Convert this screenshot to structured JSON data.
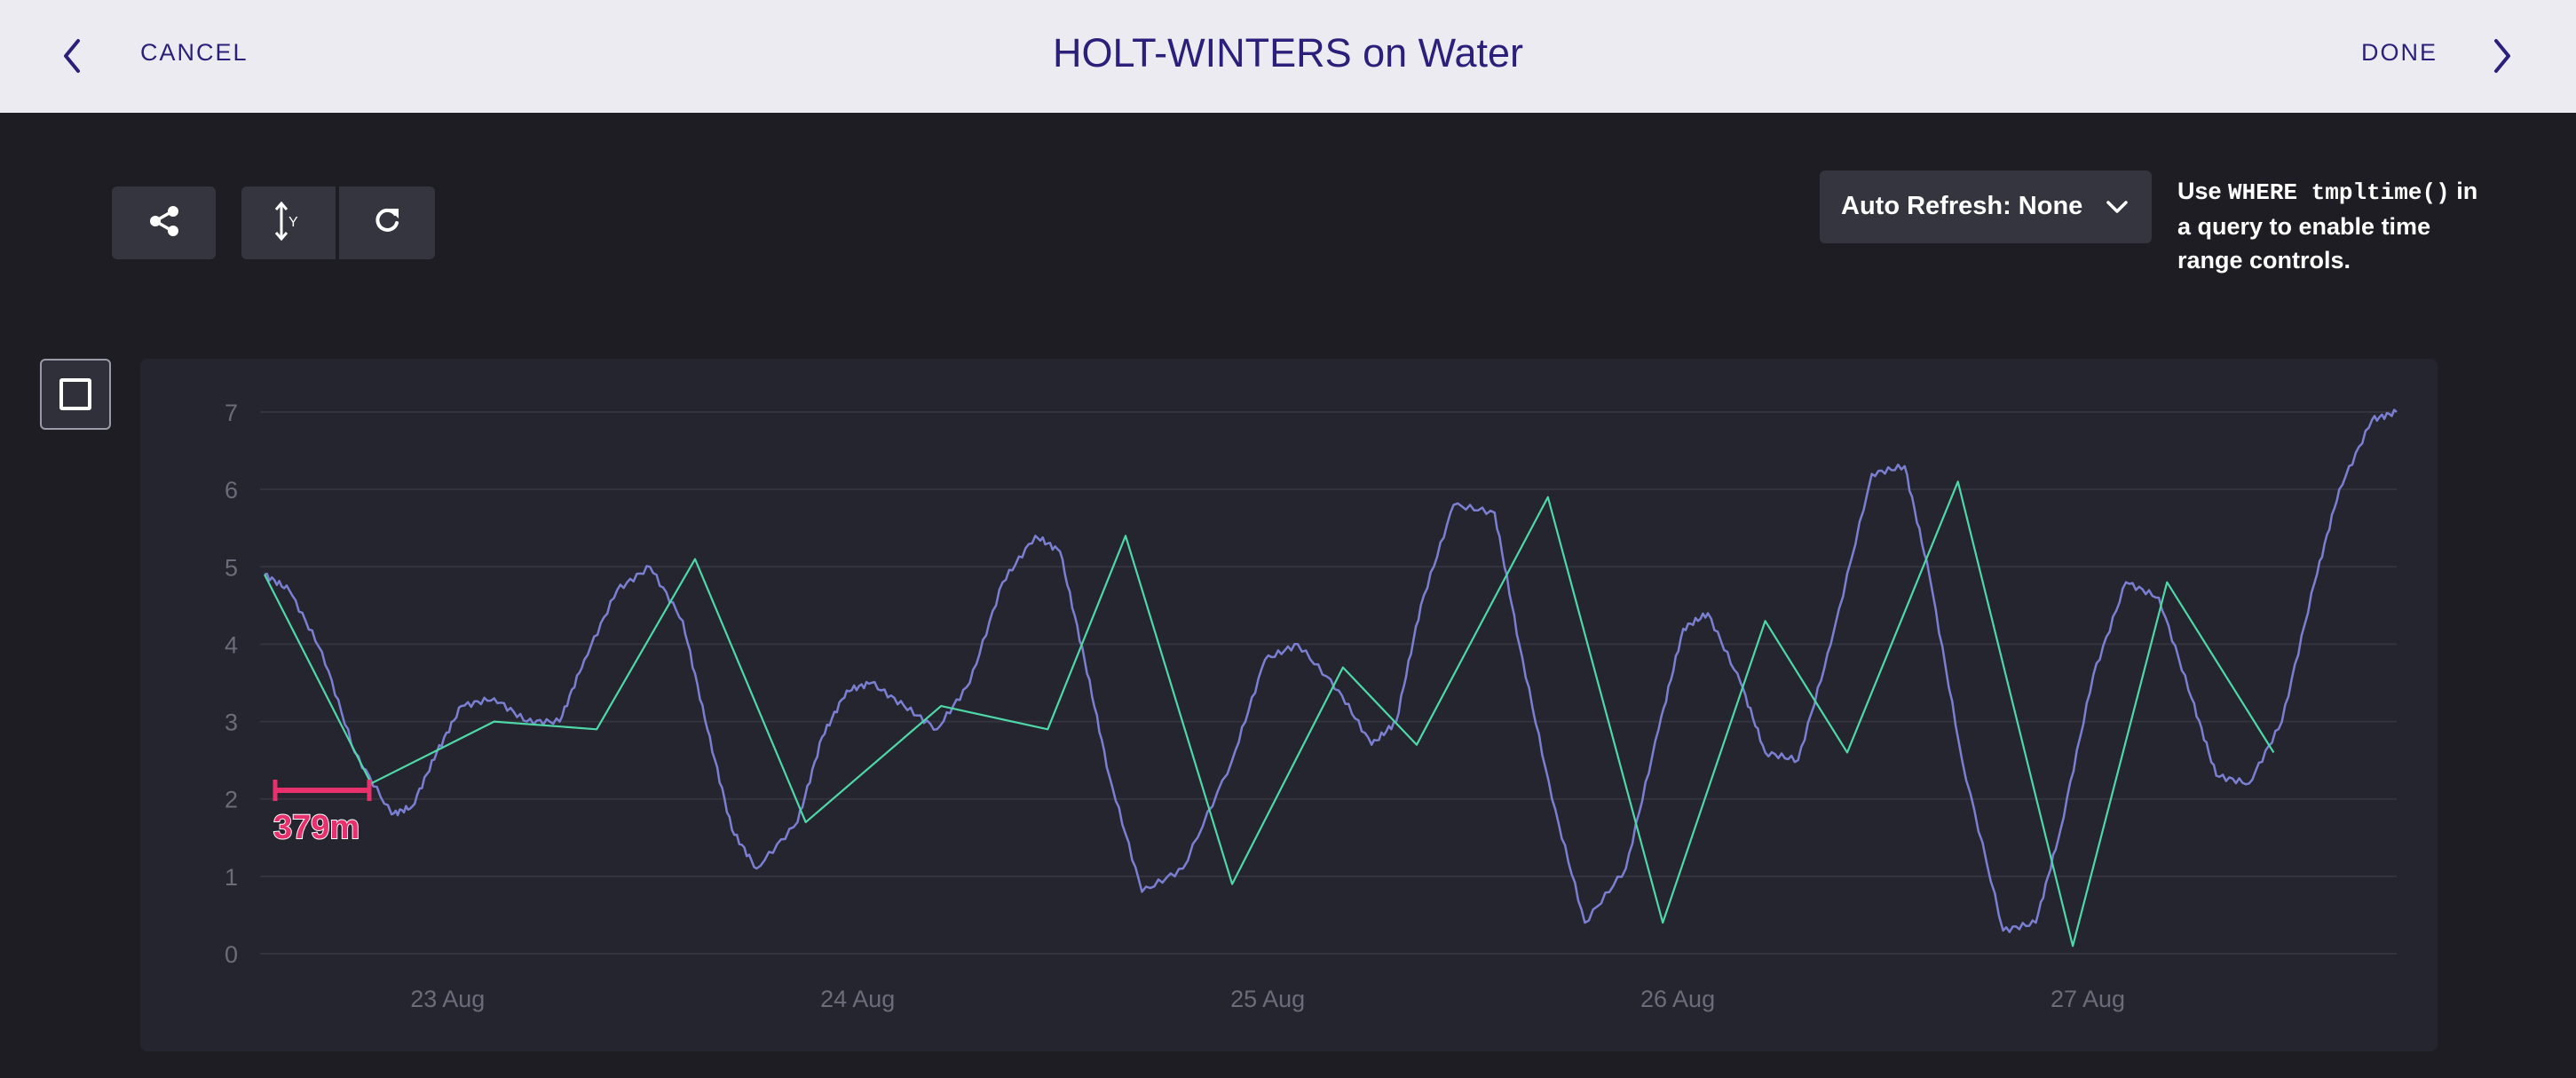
{
  "navbar": {
    "cancel_label": "CANCEL",
    "title": "HOLT-WINTERS on Water",
    "done_label": "DONE"
  },
  "toolbar": {
    "icons": [
      "share-icon",
      "y-axis-icon",
      "refresh-icon"
    ],
    "auto_refresh_label": "Auto Refresh: None",
    "hint_prefix": "Use ",
    "hint_code": "WHERE tmpltime()",
    "hint_suffix": " in a query to enable time range controls."
  },
  "colors": {
    "navbar_bg": "#ebebf1",
    "accent": "#2a1f7a",
    "background": "#1d1d23",
    "panel": "#25252f",
    "raw_series": "#7b7fd1",
    "forecast_series": "#4ed8a8",
    "interval_marker": "#e8306c"
  },
  "chart_data": {
    "type": "line",
    "y_ticks": [
      "0",
      "1",
      "2",
      "3",
      "4",
      "5",
      "6",
      "7"
    ],
    "ylim": [
      0,
      7
    ],
    "x_ticks": [
      "23 Aug",
      "24 Aug",
      "25 Aug",
      "26 Aug",
      "27 Aug"
    ],
    "xlim_days": [
      22.64,
      27.84
    ],
    "grid": true,
    "interval_label": "379m",
    "series": [
      {
        "color": "#7b7fd1",
        "x": [
          22.64,
          22.7,
          22.78,
          22.86,
          22.95,
          23.0,
          23.06,
          23.12,
          23.2,
          23.28,
          23.36,
          23.42,
          23.5,
          23.58,
          23.66,
          23.72,
          23.78,
          23.84,
          23.94,
          24.0,
          24.06,
          24.12,
          24.2,
          24.28,
          24.36,
          24.44,
          24.52,
          24.58,
          24.64,
          24.7,
          24.78,
          24.88,
          25.0,
          25.08,
          25.16,
          25.26,
          25.34,
          25.4,
          25.46,
          25.54,
          25.64,
          25.7,
          25.78,
          25.86,
          25.96,
          26.04,
          26.1,
          26.16,
          26.24,
          26.3,
          26.38,
          26.46,
          26.56,
          26.64,
          26.7,
          26.78,
          26.88,
          26.96,
          27.02,
          27.1,
          27.18,
          27.26,
          27.34,
          27.4,
          27.48,
          27.56,
          27.64,
          27.7,
          27.78,
          27.84
        ],
        "values": [
          4.9,
          4.7,
          3.9,
          2.6,
          1.8,
          1.9,
          2.6,
          3.2,
          3.3,
          3.0,
          3.0,
          3.8,
          4.7,
          5.0,
          4.3,
          2.9,
          1.6,
          1.1,
          1.7,
          2.8,
          3.4,
          3.5,
          3.2,
          2.9,
          3.5,
          4.8,
          5.4,
          5.2,
          3.8,
          2.3,
          0.8,
          1.1,
          2.5,
          3.8,
          4.0,
          3.4,
          2.7,
          3.0,
          4.5,
          5.8,
          5.7,
          4.0,
          2.0,
          0.4,
          1.1,
          2.9,
          4.2,
          4.4,
          3.5,
          2.6,
          2.5,
          4.0,
          6.2,
          6.3,
          4.9,
          2.5,
          0.3,
          0.4,
          1.6,
          3.6,
          4.8,
          4.6,
          3.3,
          2.3,
          2.2,
          3.0,
          4.8,
          6.0,
          6.9,
          7.0
        ]
      },
      {
        "color": "#4ed8a8",
        "x": [
          22.64,
          22.9,
          23.2,
          23.45,
          23.69,
          23.96,
          24.29,
          24.55,
          24.74,
          25.0,
          25.27,
          25.45,
          25.77,
          26.05,
          26.3,
          26.5,
          26.77,
          27.05,
          27.28,
          27.54
        ],
        "values": [
          4.9,
          2.2,
          3.0,
          2.9,
          5.1,
          1.7,
          3.2,
          2.9,
          5.4,
          0.9,
          3.7,
          2.7,
          5.9,
          0.4,
          4.3,
          2.6,
          6.1,
          0.1,
          4.8,
          2.6
        ]
      }
    ]
  }
}
